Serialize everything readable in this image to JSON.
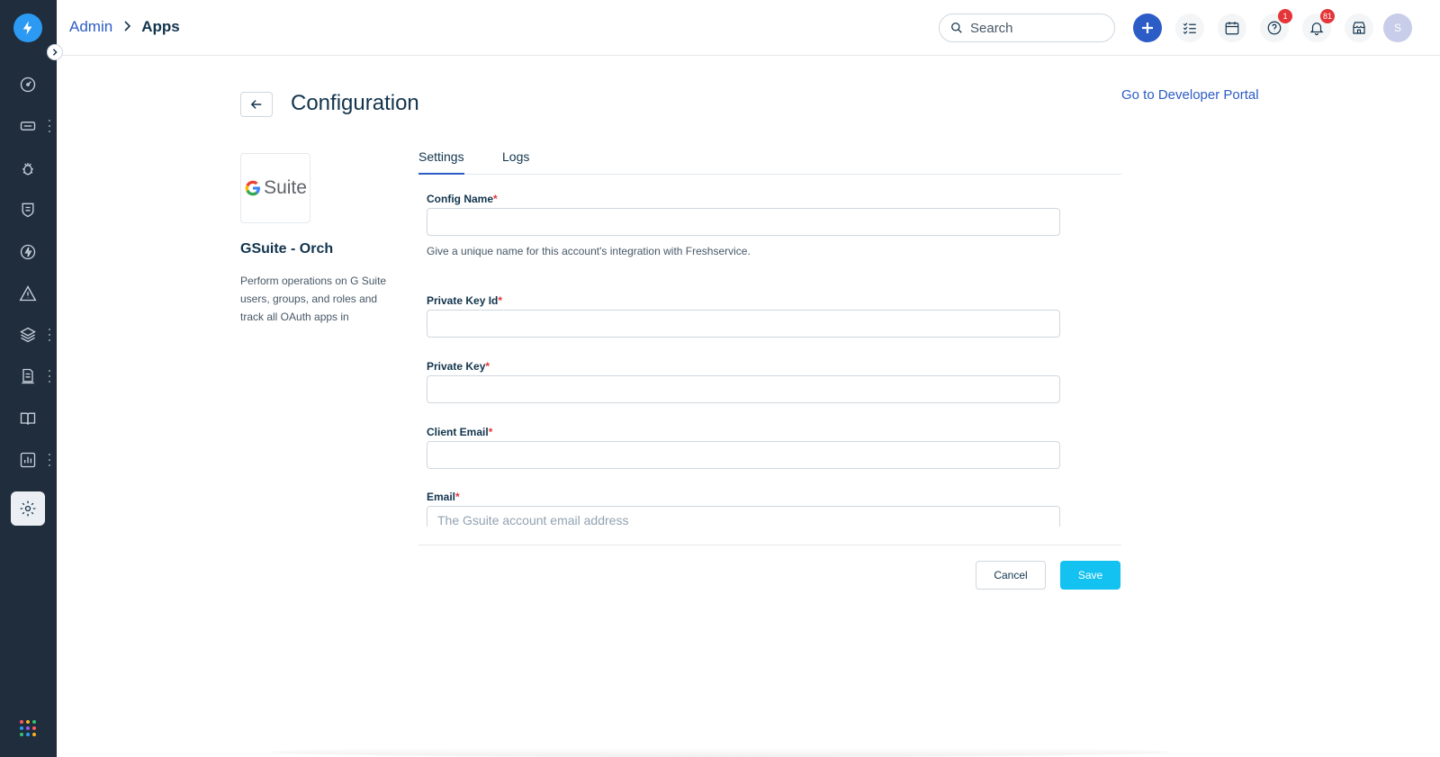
{
  "header": {
    "breadcrumb": {
      "parent": "Admin",
      "current": "Apps"
    },
    "search": {
      "placeholder": "Search"
    },
    "badges": {
      "help": "1",
      "notifications": "81"
    },
    "avatar_initial": "S"
  },
  "page": {
    "title": "Configuration",
    "developer_portal_link": "Go to Developer Portal"
  },
  "app": {
    "logo_text": "Suite",
    "name": "GSuite - Orch",
    "description": "Perform operations on G Suite users, groups, and roles and track all OAuth apps in"
  },
  "tabs": [
    {
      "label": "Settings",
      "active": true
    },
    {
      "label": "Logs",
      "active": false
    }
  ],
  "form": {
    "fields": [
      {
        "label": "Config Name",
        "required": "*",
        "value": "",
        "placeholder": "",
        "hint": "Give a unique name for this account's integration with Freshservice."
      },
      {
        "label": "Private Key Id",
        "required": "*",
        "value": "",
        "placeholder": ""
      },
      {
        "label": "Private Key",
        "required": "*",
        "value": "",
        "placeholder": ""
      },
      {
        "label": "Client Email",
        "required": "*",
        "value": "",
        "placeholder": ""
      },
      {
        "label": "Email",
        "required": "*",
        "value": "",
        "placeholder": "The Gsuite account email address"
      }
    ]
  },
  "actions": {
    "cancel": "Cancel",
    "save": "Save"
  },
  "colors": {
    "sidebar": "#1f2d3d",
    "primary": "#2c5cc5",
    "save": "#13c2f0",
    "badge": "#e43538",
    "logo": "#2c9af2"
  },
  "icons": {
    "sidebar": [
      "dashboard-icon",
      "tickets-icon",
      "problems-icon",
      "changes-icon",
      "releases-icon",
      "alerts-icon",
      "assets-icon",
      "contracts-icon",
      "solutions-icon",
      "analytics-icon",
      "admin-gear-icon"
    ],
    "header": [
      "search-icon",
      "plus-icon",
      "tasks-icon",
      "calendar-icon",
      "help-icon",
      "bell-icon",
      "marketplace-icon"
    ]
  }
}
